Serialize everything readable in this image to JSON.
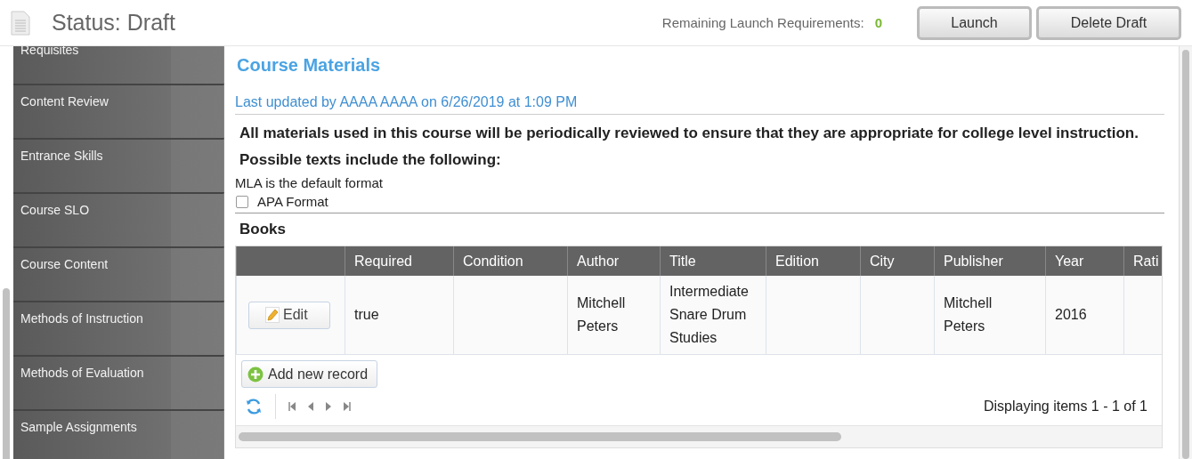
{
  "header": {
    "status": "Status: Draft",
    "requirements_label": "Remaining Launch Requirements:",
    "requirements_count": "0",
    "buttons": [
      "Launch",
      "Delete Draft"
    ]
  },
  "sidebar": {
    "items": [
      {
        "label": "Requisites"
      },
      {
        "label": "Content Review"
      },
      {
        "label": "Entrance Skills"
      },
      {
        "label": "Course SLO"
      },
      {
        "label": "Course Content"
      },
      {
        "label": "Methods of Instruction"
      },
      {
        "label": "Methods of Evaluation"
      },
      {
        "label": "Sample Assignments"
      }
    ]
  },
  "section": {
    "title": "Course Materials",
    "last_updated": "Last updated by AAAA AAAA on 6/26/2019 at 1:09 PM",
    "statement": "All materials used in this course will be periodically reviewed to ensure that they are appropriate for college level instruction. Possible texts include the following:",
    "note": "MLA is the default format",
    "apa_format": {
      "label": "APA Format",
      "checked": false
    }
  },
  "books": {
    "title": "Books",
    "columns": [
      "Required",
      "Condition",
      "Author",
      "Title",
      "Edition",
      "City",
      "Publisher",
      "Year",
      "Rati"
    ],
    "rows": [
      {
        "edit_label": "Edit",
        "cells": [
          {
            "text": "true"
          },
          {},
          {
            "text": "Mitchell Peters"
          },
          {
            "text": "Intermediate Snare Drum Studies"
          },
          {},
          {},
          {
            "text": "Mitchell Peters"
          },
          {
            "text": "2016"
          },
          {}
        ]
      }
    ],
    "add_label": "Add new record",
    "pager_info": "Displaying items 1 - 1 of 1"
  }
}
